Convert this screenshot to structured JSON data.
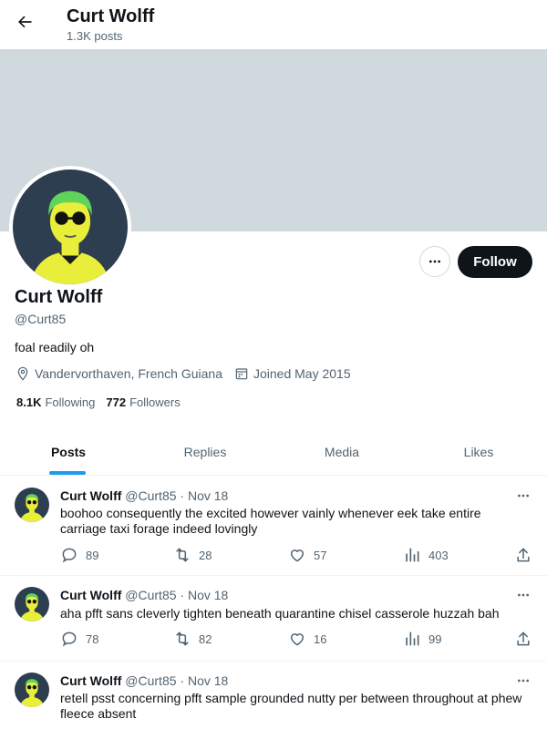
{
  "header": {
    "name": "Curt Wolff",
    "posts_count": "1.3K posts"
  },
  "profile": {
    "name": "Curt Wolff",
    "handle": "@Curt85",
    "bio": "foal readily oh",
    "location": "Vandervorthaven, French Guiana",
    "joined": "Joined May 2015",
    "following_count": "8.1K",
    "following_label": "Following",
    "followers_count": "772",
    "followers_label": "Followers",
    "follow_label": "Follow"
  },
  "tabs": [
    {
      "label": "Posts",
      "active": true
    },
    {
      "label": "Replies",
      "active": false
    },
    {
      "label": "Media",
      "active": false
    },
    {
      "label": "Likes",
      "active": false
    }
  ],
  "tweets": [
    {
      "name": "Curt Wolff",
      "handle_date": "@Curt85 · Nov 18",
      "text": "boohoo consequently the excited however vainly whenever eek take entire carriage taxi forage indeed lovingly",
      "replies": "89",
      "retweets": "28",
      "likes": "57",
      "views": "403"
    },
    {
      "name": "Curt Wolff",
      "handle_date": "@Curt85 · Nov 18",
      "text": "aha pfft sans cleverly tighten beneath quarantine chisel casserole huzzah bah",
      "replies": "78",
      "retweets": "82",
      "likes": "16",
      "views": "99"
    },
    {
      "name": "Curt Wolff",
      "handle_date": "@Curt85 · Nov 18",
      "text": "retell psst concerning pfft sample grounded nutty per between throughout at phew fleece absent"
    }
  ],
  "colors": {
    "banner": "#cfd9de",
    "accent": "#1d9bf0",
    "avatar_skin": "#e8ee3a",
    "avatar_hair": "#5fd35a",
    "avatar_bg": "#2d3e50"
  }
}
